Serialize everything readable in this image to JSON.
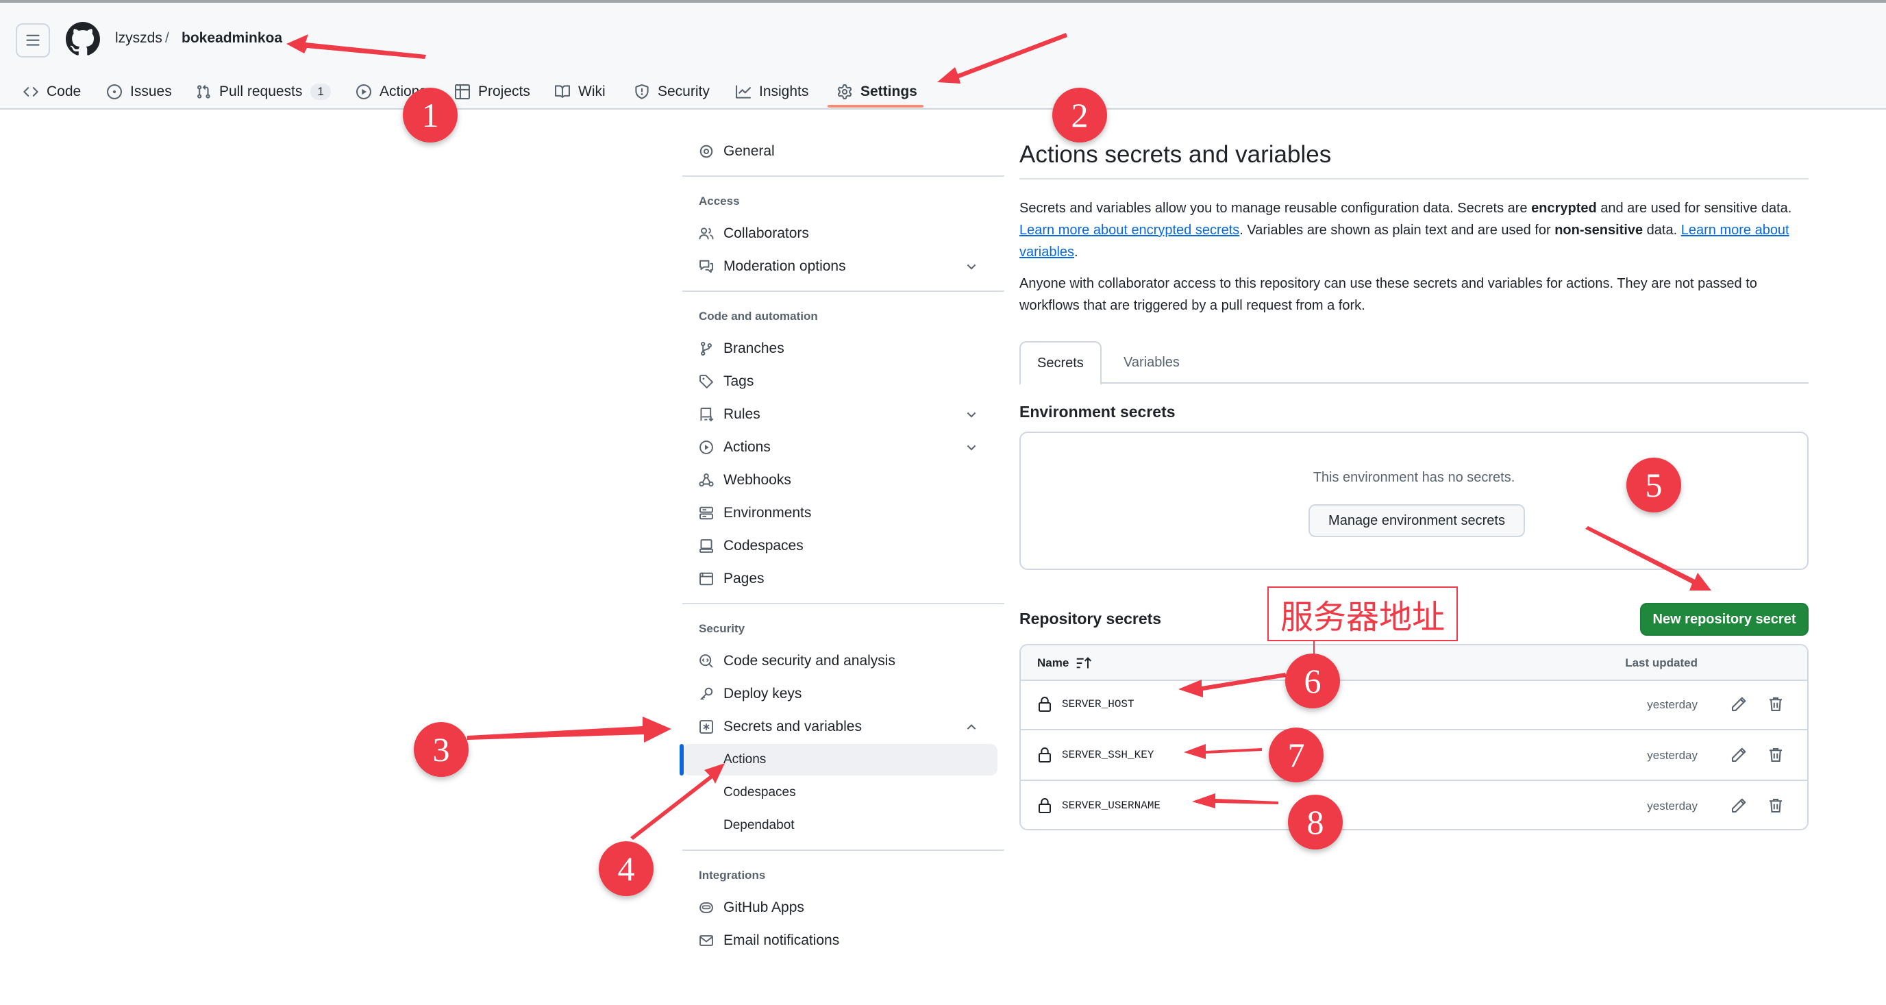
{
  "header": {
    "owner": "lzyszds",
    "separator": "/",
    "repo": "bokeadminkoa",
    "tabs": [
      {
        "label": "Code",
        "icon": "code-icon"
      },
      {
        "label": "Issues",
        "icon": "issue-icon"
      },
      {
        "label": "Pull requests",
        "icon": "pull-request-icon",
        "count": "1"
      },
      {
        "label": "Actions",
        "icon": "play-icon"
      },
      {
        "label": "Projects",
        "icon": "table-icon"
      },
      {
        "label": "Wiki",
        "icon": "book-icon"
      },
      {
        "label": "Security",
        "icon": "shield-icon"
      },
      {
        "label": "Insights",
        "icon": "graph-icon"
      },
      {
        "label": "Settings",
        "icon": "gear-icon",
        "selected": true
      }
    ]
  },
  "sidebar": {
    "general": "General",
    "headings": {
      "access": "Access",
      "code_automation": "Code and automation",
      "security": "Security",
      "integrations": "Integrations"
    },
    "items": {
      "collaborators": "Collaborators",
      "moderation": "Moderation options",
      "branches": "Branches",
      "tags": "Tags",
      "rules": "Rules",
      "actions": "Actions",
      "webhooks": "Webhooks",
      "environments": "Environments",
      "codespaces": "Codespaces",
      "pages": "Pages",
      "code_security": "Code security and analysis",
      "deploy_keys": "Deploy keys",
      "secrets_variables": "Secrets and variables",
      "sub_actions": "Actions",
      "sub_codespaces": "Codespaces",
      "sub_dependabot": "Dependabot",
      "github_apps": "GitHub Apps",
      "email_notifications": "Email notifications"
    }
  },
  "main": {
    "title": "Actions secrets and variables",
    "intro": {
      "p1_a": "Secrets and variables allow you to manage reusable configuration data. Secrets are ",
      "p1_b": "encrypted",
      "p1_c": " and are used for sensitive data. ",
      "p1_link1": "Learn more about encrypted secrets",
      "p1_d": ". Variables are shown as plain text and are used for ",
      "p1_e": "non-sensitive",
      "p1_f": " data. ",
      "p1_link2": "Learn more about variables",
      "p1_g": ".",
      "p2": "Anyone with collaborator access to this repository can use these secrets and variables for actions. They are not passed to workflows that are triggered by a pull request from a fork."
    },
    "tabs": {
      "secrets": "Secrets",
      "variables": "Variables"
    },
    "env_title": "Environment secrets",
    "env_empty": "This environment has no secrets.",
    "env_button": "Manage environment secrets",
    "repo_title": "Repository secrets",
    "new_secret_button": "New repository secret",
    "table": {
      "col_name": "Name",
      "col_updated": "Last updated",
      "rows": [
        {
          "name": "SERVER_HOST",
          "updated": "yesterday"
        },
        {
          "name": "SERVER_SSH_KEY",
          "updated": "yesterday"
        },
        {
          "name": "SERVER_USERNAME",
          "updated": "yesterday"
        }
      ]
    }
  },
  "annotations": {
    "badges": [
      "1",
      "2",
      "3",
      "4",
      "5",
      "6",
      "7",
      "8"
    ],
    "note": "服务器地址",
    "accent": "#ee3b47"
  },
  "colors": {
    "link": "#0969da",
    "primary_button": "#1f883d",
    "selected_tab_underline": "#fd8c73",
    "active_indicator": "#0969da"
  }
}
